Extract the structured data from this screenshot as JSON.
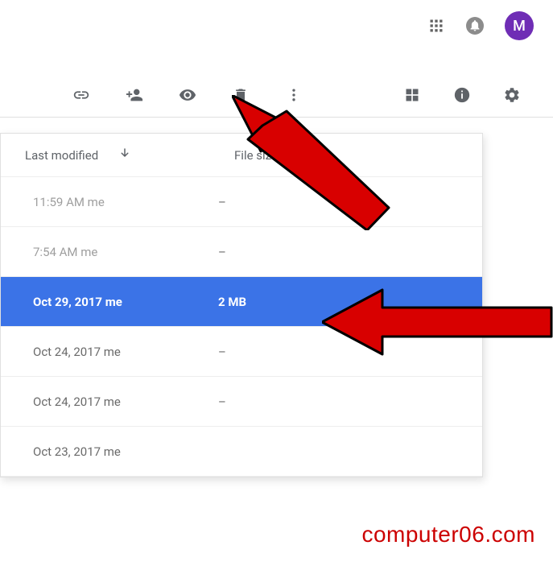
{
  "header": {
    "avatar_initial": "M"
  },
  "toolbar": {
    "icons": {
      "link": "get-link",
      "share": "add-people",
      "preview": "preview",
      "remove": "remove",
      "more": "more-actions",
      "grid": "grid-view",
      "details": "view-details",
      "settings": "settings"
    }
  },
  "columns": {
    "last_modified": "Last modified",
    "file_size": "File size"
  },
  "rows": [
    {
      "date": "11:59 AM me",
      "size": "–",
      "tone": "light",
      "selected": false
    },
    {
      "date": "7:54 AM me",
      "size": "–",
      "tone": "light",
      "selected": false
    },
    {
      "date": "Oct 29, 2017 me",
      "size": "2 MB",
      "tone": "dark",
      "selected": true
    },
    {
      "date": "Oct 24, 2017 me",
      "size": "–",
      "tone": "dark",
      "selected": false
    },
    {
      "date": "Oct 24, 2017 me",
      "size": "–",
      "tone": "dark",
      "selected": false
    },
    {
      "date": "Oct 23, 2017 me",
      "size": "",
      "tone": "dark",
      "selected": false
    }
  ],
  "watermark": "computer06.com"
}
